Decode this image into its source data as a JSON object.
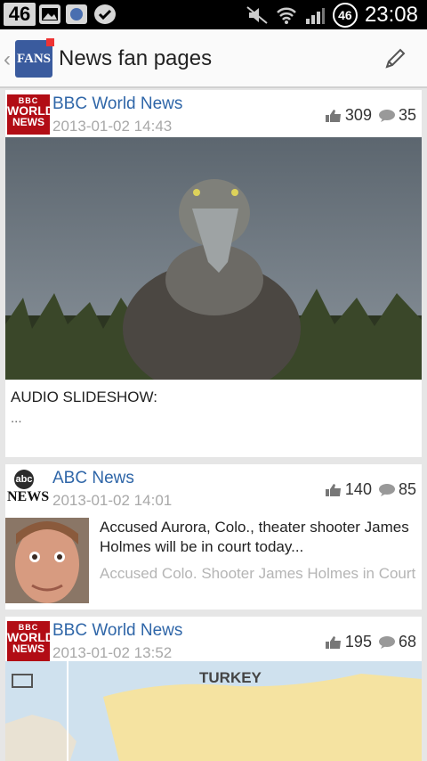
{
  "status_bar": {
    "left_badge": "46",
    "battery_level": "46",
    "time": "23:08"
  },
  "action_bar": {
    "logo_text": "FANS",
    "title": "News fan pages"
  },
  "posts": [
    {
      "logo": {
        "line1": "BBC",
        "line2": "WORLD",
        "line3": "NEWS"
      },
      "source": "BBC World News",
      "date": "2013-01-02 14:43",
      "likes": "309",
      "comments": "35",
      "text": "AUDIO SLIDESHOW:",
      "subtext": "..."
    },
    {
      "logo": {
        "line1": "abc",
        "line2": "NEWS"
      },
      "source": "ABC News",
      "date": "2013-01-02 14:01",
      "likes": "140",
      "comments": "85",
      "headline": "Accused Aurora, Colo., theater shooter James Holmes will be in court today...",
      "subline": "Accused Colo. Shooter James Holmes in Court"
    },
    {
      "logo": {
        "line1": "BBC",
        "line2": "WORLD",
        "line3": "NEWS"
      },
      "source": "BBC World News",
      "date": "2013-01-02 13:52",
      "likes": "195",
      "comments": "68",
      "map_label": "TURKEY"
    }
  ],
  "colors": {
    "link_blue": "#2f66a8",
    "bbc_red": "#b20d15",
    "fans_blue": "#3a5b9e"
  }
}
